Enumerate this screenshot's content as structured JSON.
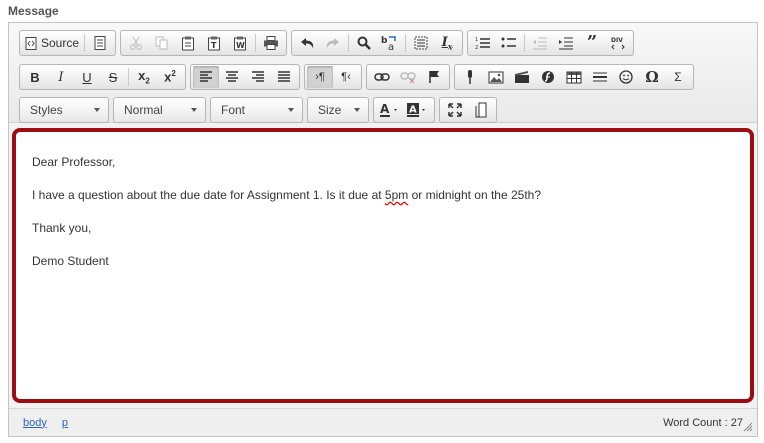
{
  "field": {
    "label": "Message"
  },
  "toolbar": {
    "source_label": "Source",
    "styles": "Styles",
    "format": "Normal",
    "font": "Font",
    "size": "Size"
  },
  "content": {
    "line1": "Dear Professor,",
    "line2_a": "I have a question about the due date for Assignment 1. Is it due at ",
    "line2_b": "5pm",
    "line2_c": " or midnight on the 25th?",
    "line3": "Thank you,",
    "line4": "Demo Student"
  },
  "status": {
    "path": [
      "body",
      "p"
    ],
    "word_count_label": "Word Count : 27"
  },
  "colors": {
    "highlight_border": "#9b0c13",
    "link": "#2d63b5"
  }
}
